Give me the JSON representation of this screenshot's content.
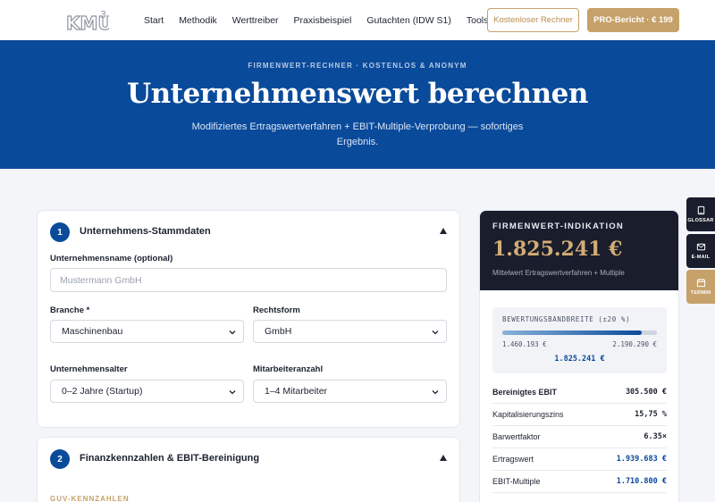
{
  "brand": {
    "logo_text": "KMU³"
  },
  "nav": {
    "items": [
      "Start",
      "Methodik",
      "Werttreiber",
      "Praxisbeispiel",
      "Gutachten (IDW S1)"
    ],
    "tools_label": "Tools",
    "cta_outline": "Kostenloser Rechner",
    "cta_primary": "PRO-Bericht · € 199"
  },
  "hero": {
    "eyebrow": "FIRMENWERT-RECHNER · KOSTENLOS & ANONYM",
    "title": "Unternehmenswert berechnen",
    "subtitle": "Modifiziertes Ertragswertverfahren + EBIT-Multiple-Verprobung — sofortiges Ergebnis."
  },
  "step1": {
    "number": "1",
    "title": "Unternehmens-Stammdaten",
    "company_label": "Unternehmensname (optional)",
    "company_placeholder": "Mustermann GmbH",
    "branche_label": "Branche *",
    "branche_value": "Maschinenbau",
    "rechtsform_label": "Rechtsform",
    "rechtsform_value": "GmbH",
    "alter_label": "Unternehmensalter",
    "alter_value": "0–2 Jahre (Startup)",
    "mitarbeiter_label": "Mitarbeiteranzahl",
    "mitarbeiter_value": "1–4 Mitarbeiter"
  },
  "step2": {
    "number": "2",
    "title": "Finanzkennzahlen & EBIT-Bereinigung",
    "section": "GUV-KENNZAHLEN"
  },
  "result": {
    "title": "FIRMENWERT-INDIKATION",
    "value": "1.825.241 €",
    "subtitle": "Mittelwert Ertragswertverfahren + Multiple",
    "range": {
      "title": "BEWERTUNGSBANDBREITE (±20 %)",
      "low": "1.460.193 €",
      "high": "2.190.290 €",
      "mid": "1.825.241 €",
      "fill_start": 0.0,
      "fill_end": 0.9
    },
    "rows": [
      {
        "k": "Bereinigtes EBIT",
        "v": "305.500 €",
        "bold": true,
        "blue": false
      },
      {
        "k": "Kapitalisierungszins",
        "v": "15,75 %",
        "bold": false,
        "blue": false
      },
      {
        "k": "Barwertfaktor",
        "v": "6.35×",
        "bold": false,
        "blue": false
      },
      {
        "k": "Ertragswert",
        "v": "1.939.683 €",
        "bold": false,
        "blue": true
      },
      {
        "k": "EBIT-Multiple",
        "v": "1.710.800 €",
        "bold": false,
        "blue": true
      }
    ]
  },
  "dock": {
    "glossar": "GLOSSAR",
    "email": "E-MAIL",
    "termin": "TERMIN"
  }
}
